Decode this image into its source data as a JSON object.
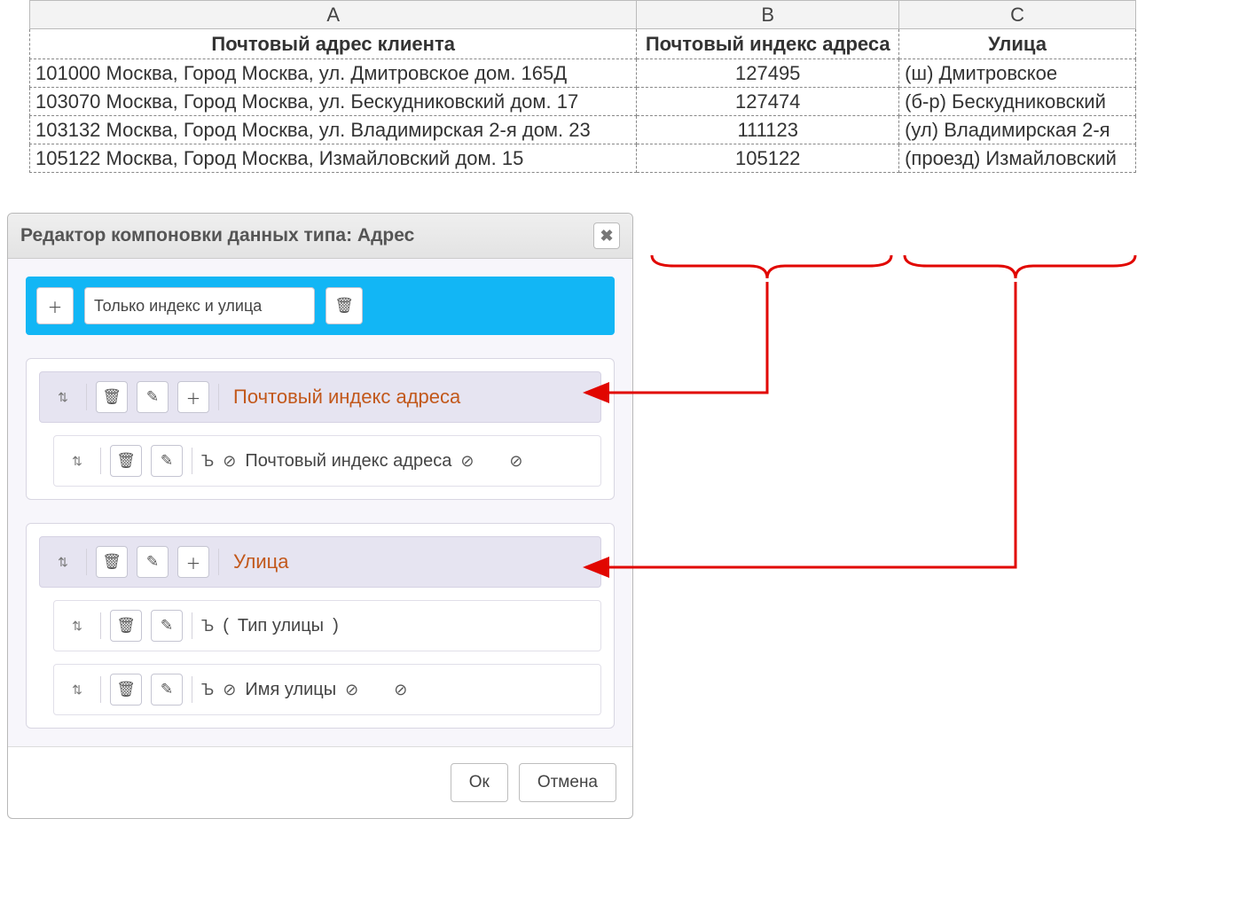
{
  "sheet": {
    "col_letters": [
      "A",
      "B",
      "C"
    ],
    "headers": [
      "Почтовый адрес клиента",
      "Почтовый индекс адреса",
      "Улица"
    ],
    "rows": [
      {
        "a": "101000 Москва, Город Москва, ул. Дмитровское дом. 165Д",
        "b": "127495",
        "c": "(ш) Дмитровское"
      },
      {
        "a": "103070 Москва, Город Москва, ул. Бескудниковский дом. 17",
        "b": "127474",
        "c": "(б-р) Бескудниковский"
      },
      {
        "a": "103132 Москва, Город Москва, ул. Владимирская 2-я дом. 23",
        "b": "111123",
        "c": "(ул) Владимирская 2-я"
      },
      {
        "a": "105122 Москва, Город Москва, Измайловский дом. 15",
        "b": "105122",
        "c": "(проезд) Измайловский"
      }
    ]
  },
  "panel": {
    "title": "Редактор компоновки данных типа: Адрес",
    "top_input": "Только индекс и улица",
    "ok": "Ок",
    "cancel": "Отмена",
    "groups": [
      {
        "title": "Почтовый индекс адреса",
        "rows": [
          {
            "prefix": "",
            "parts": [
              "⊘",
              "Почтовый индекс адреса",
              "⊘",
              "",
              "⊘"
            ]
          }
        ]
      },
      {
        "title": "Улица",
        "rows": [
          {
            "prefix": "",
            "parts": [
              "(",
              "Тип улицы",
              ")"
            ]
          },
          {
            "prefix": "",
            "parts": [
              "⊘",
              "Имя улицы",
              "⊘",
              "",
              "⊘"
            ]
          }
        ]
      }
    ]
  },
  "icons": {
    "plus": "＋",
    "trash": "🗑",
    "pencil": "✎",
    "updown": "⇅",
    "close": "✖",
    "key": "Ъ",
    "noentry": "⊘"
  },
  "colors": {
    "accent": "#12b6f5",
    "group_title": "#c2581b",
    "arrow": "#e10600"
  }
}
